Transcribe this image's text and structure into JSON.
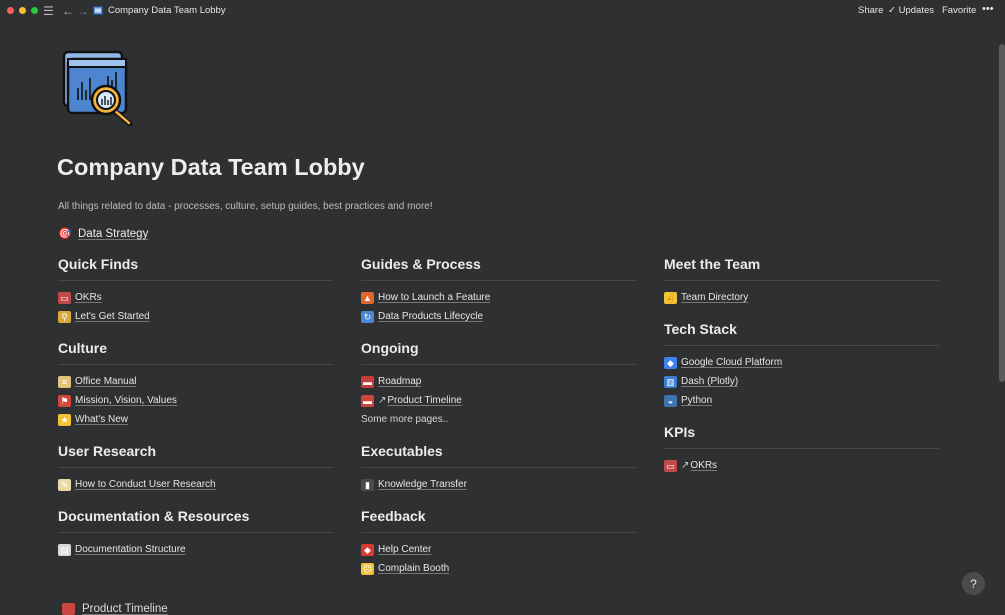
{
  "window": {
    "title": "Company Data Team Lobby",
    "actions": {
      "share": "Share",
      "updates": "Updates",
      "favorite": "Favorite",
      "more": "•••"
    }
  },
  "page": {
    "title": "Company Data Team Lobby",
    "subtitle": "All things related to data - processes, culture, setup guides, best practices and more!",
    "strategy_link": "Data Strategy"
  },
  "columns": [
    {
      "sections": [
        {
          "title": "Quick Finds",
          "items": [
            {
              "label": "OKRs",
              "icon": "book-icon",
              "linked": true
            },
            {
              "label": "Let's Get Started",
              "icon": "bike-icon",
              "linked": true
            }
          ]
        },
        {
          "title": "Culture",
          "items": [
            {
              "label": "Office Manual",
              "icon": "scroll-icon",
              "linked": true
            },
            {
              "label": "Mission, Vision, Values",
              "icon": "flag-icon",
              "linked": true
            },
            {
              "label": "What's New",
              "icon": "star-icon",
              "linked": true
            }
          ]
        },
        {
          "title": "User Research",
          "items": [
            {
              "label": "How to Conduct User Research",
              "icon": "memo-icon",
              "linked": true
            }
          ]
        },
        {
          "title": "Documentation & Resources",
          "items": [
            {
              "label": "Documentation Structure",
              "icon": "document-icon",
              "linked": true
            }
          ]
        }
      ]
    },
    {
      "sections": [
        {
          "title": "Guides & Process",
          "items": [
            {
              "label": "How to Launch a Feature",
              "icon": "fire-icon",
              "linked": true
            },
            {
              "label": "Data Products Lifecycle",
              "icon": "cycle-icon",
              "linked": true
            }
          ]
        },
        {
          "title": "Ongoing",
          "items": [
            {
              "label": "Roadmap",
              "icon": "car-icon",
              "linked": true
            },
            {
              "label": "Product Timeline",
              "icon": "train-icon",
              "linked": true,
              "arrow": "↗"
            }
          ],
          "note": "Some more pages.."
        },
        {
          "title": "Executables",
          "items": [
            {
              "label": "Knowledge Transfer",
              "icon": "notebook-icon",
              "linked": true
            }
          ]
        },
        {
          "title": "Feedback",
          "items": [
            {
              "label": "Help Center",
              "icon": "siren-icon",
              "linked": true
            },
            {
              "label": "Complain Booth",
              "icon": "sad-face-icon",
              "linked": true
            }
          ]
        }
      ]
    },
    {
      "sections": [
        {
          "title": "Meet the Team",
          "items": [
            {
              "label": "Team Directory",
              "icon": "victory-hand-icon",
              "linked": true
            }
          ]
        },
        {
          "title": "Tech Stack",
          "items": [
            {
              "label": "Google Cloud Platform",
              "icon": "gcp-icon",
              "linked": true
            },
            {
              "label": "Dash (Plotly)",
              "icon": "bar-chart-icon",
              "linked": true
            },
            {
              "label": "Python",
              "icon": "python-icon",
              "linked": true
            }
          ]
        },
        {
          "title": "KPIs",
          "items": [
            {
              "label": "OKRs",
              "icon": "book-icon",
              "linked": true,
              "arrow": "↗"
            }
          ]
        }
      ]
    }
  ],
  "footer": {
    "partial_link": "Product Timeline"
  },
  "help": "?"
}
